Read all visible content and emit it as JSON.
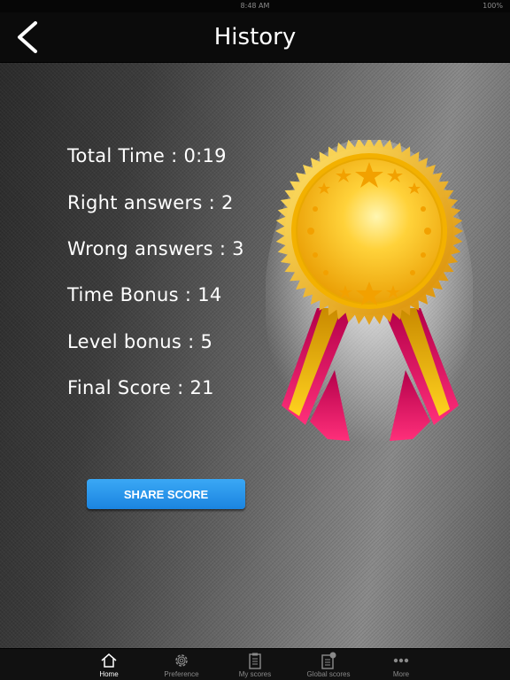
{
  "status_bar": {
    "time": "8:48 AM",
    "battery": "100%"
  },
  "header": {
    "title": "History",
    "back_icon": "chevron-left-icon"
  },
  "stats": [
    {
      "label": "Total Time : 0:19"
    },
    {
      "label": "Right answers : 2"
    },
    {
      "label": "Wrong answers : 3"
    },
    {
      "label": "Time Bonus : 14"
    },
    {
      "label": "Level bonus : 5"
    },
    {
      "label": "Final Score : 21"
    }
  ],
  "medal": {
    "icon": "gold-medal-ribbon-icon",
    "colors": {
      "gold": "#f7c21a",
      "ribbon": "#e0115f",
      "ribbon_gold": "#f0b400"
    }
  },
  "share_button": {
    "label": "SHARE SCORE",
    "color": "#2196f3"
  },
  "tab_bar": {
    "items": [
      {
        "label": "Home",
        "icon": "home-icon",
        "active": true
      },
      {
        "label": "Preference",
        "icon": "gear-icon",
        "active": false
      },
      {
        "label": "My scores",
        "icon": "clipboard-icon",
        "active": false
      },
      {
        "label": "Global scores",
        "icon": "global-scores-icon",
        "active": false
      },
      {
        "label": "More",
        "icon": "more-dots-icon",
        "active": false
      }
    ]
  }
}
